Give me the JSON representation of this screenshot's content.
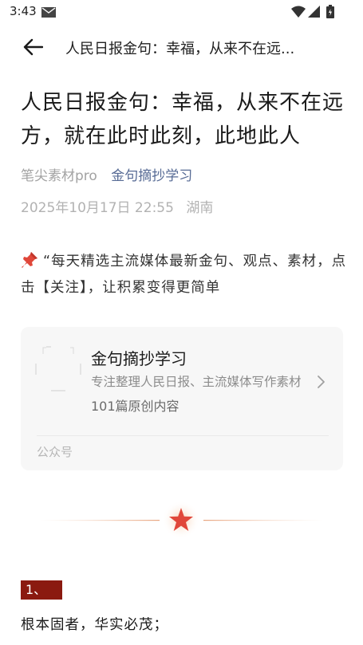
{
  "status_bar": {
    "time": "3:43"
  },
  "app_bar": {
    "title": "人民日报金句：幸福，从来不在远..."
  },
  "article": {
    "title": "人民日报金句：幸福，从来不在远方，就在此时此刻，此地此人",
    "author": "笔尖素材pro",
    "account": "金句摘抄学习",
    "datetime": "2025年10月17日 22:55",
    "location": "湖南",
    "intro": "“每天精选主流媒体最新金句、观点、素材，点击【关注】，让积累变得更简单"
  },
  "profile_card": {
    "name": "金句摘抄学习",
    "description": "专注整理人民日报、主流媒体写作素材",
    "count": "101篇原创内容",
    "type_label": "公众号"
  },
  "section": {
    "tag": "1、",
    "line": "根本固者，华实必茂；"
  },
  "colors": {
    "link": "#576b95",
    "section_tag_bg": "#8b1a10",
    "star": "#e0473a",
    "card_bg": "#f7f7f7"
  },
  "icons": {
    "back": "arrow-left-icon",
    "mail": "mail-icon",
    "wifi": "wifi-icon",
    "signal": "signal-icon",
    "battery": "battery-icon",
    "pin": "pushpin-icon",
    "chevron": "chevron-right-icon",
    "star": "star-icon"
  }
}
